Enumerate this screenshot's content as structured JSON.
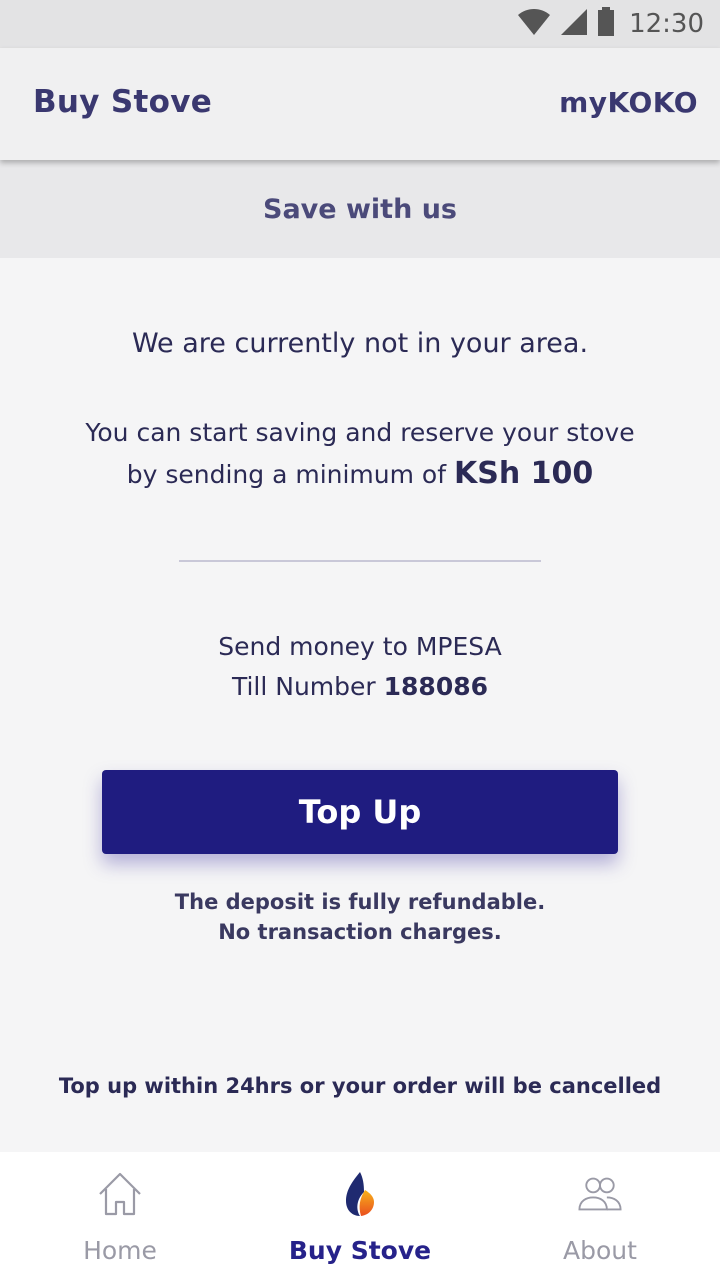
{
  "status_bar": {
    "time": "12:30"
  },
  "app_bar": {
    "title": "Buy Stove",
    "brand": "myKOKO"
  },
  "section": {
    "title": "Save with us"
  },
  "content": {
    "not_in_area": "We are currently not in your area.",
    "saving_line1": "You can start saving and reserve your stove",
    "saving_line2_prefix": "by sending a minimum of",
    "minimum_amount": "KSh 100",
    "mpesa_line1": "Send money to MPESA",
    "till_label": "Till Number",
    "till_number": "188086",
    "topup_label": "Top Up",
    "refund_line1": "The deposit is fully refundable.",
    "refund_line2": "No transaction charges.",
    "warning": "Top up within 24hrs or your order will be cancelled"
  },
  "bottom_nav": {
    "items": [
      {
        "label": "Home",
        "icon": "home-icon",
        "active": false
      },
      {
        "label": "Buy Stove",
        "icon": "flame-icon",
        "active": true
      },
      {
        "label": "About",
        "icon": "people-icon",
        "active": false
      }
    ]
  },
  "colors": {
    "primary": "#1f1c80",
    "text_dark": "#2b2a55",
    "nav_inactive": "#9a9aa6"
  }
}
